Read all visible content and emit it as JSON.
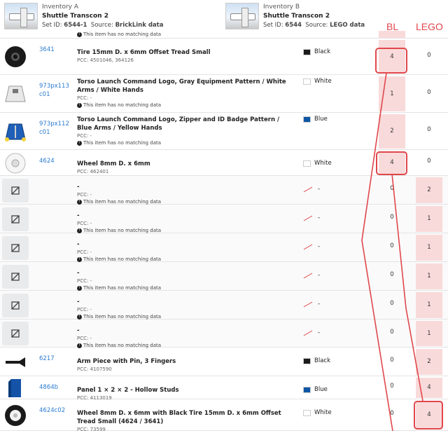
{
  "inventory_a": {
    "label": "Inventory A",
    "name": "Shuttle Transcon 2",
    "set_id_label": "Set ID:",
    "set_id": "6544-1",
    "source_label": "Source:",
    "source": "BrickLink data"
  },
  "inventory_b": {
    "label": "Inventory B",
    "name": "Shuttle Transcon 2",
    "set_id_label": "Set ID:",
    "set_id": "6544",
    "source_label": "Source:",
    "source": "LEGO data"
  },
  "columns": {
    "bl": "BL",
    "lego": "LEGO"
  },
  "top_partial_note": "This item has no matching data",
  "rows": [
    {
      "id": "3641",
      "name": "Tire 15mm D. x 6mm Offset Tread Small",
      "pcc": "PCC: 4501046, 364126",
      "nomatch": "",
      "color": "Black",
      "swatch": "#1b1b1b",
      "bl": "4",
      "lego": "0",
      "thumb": "tire"
    },
    {
      "id": "973px113c01",
      "name": "Torso Launch Command Logo, Gray Equipment Pattern / White Arms / White Hands",
      "pcc": "PCC: -",
      "nomatch": "This item has no matching data",
      "color": "White",
      "swatch": "#ffffff",
      "bl": "1",
      "lego": "0",
      "thumb": "torso-white"
    },
    {
      "id": "973px112c01",
      "name": "Torso Launch Command Logo, Zipper and ID Badge Pattern / Blue Arms / Yellow Hands",
      "pcc": "PCC: -",
      "nomatch": "This item has no matching data",
      "color": "Blue",
      "swatch": "#0d56a6",
      "bl": "2",
      "lego": "0",
      "thumb": "torso-blue"
    },
    {
      "id": "4624",
      "name": "Wheel 8mm D. x 6mm",
      "pcc": "PCC: 462401",
      "nomatch": "",
      "color": "White",
      "swatch": "#ffffff",
      "bl": "4",
      "lego": "0",
      "thumb": "wheel"
    },
    {
      "id": "",
      "name": "-",
      "pcc": "PCC: -",
      "nomatch": "This item has no matching data",
      "color": "-",
      "swatch": "none",
      "bl": "0",
      "lego": "2",
      "thumb": "ph"
    },
    {
      "id": "",
      "name": "-",
      "pcc": "PCC: -",
      "nomatch": "This item has no matching data",
      "color": "-",
      "swatch": "none",
      "bl": "0",
      "lego": "1",
      "thumb": "ph"
    },
    {
      "id": "",
      "name": "-",
      "pcc": "PCC: -",
      "nomatch": "This item has no matching data",
      "color": "-",
      "swatch": "none",
      "bl": "0",
      "lego": "1",
      "thumb": "ph"
    },
    {
      "id": "",
      "name": "-",
      "pcc": "PCC: -",
      "nomatch": "This item has no matching data",
      "color": "-",
      "swatch": "none",
      "bl": "0",
      "lego": "1",
      "thumb": "ph"
    },
    {
      "id": "",
      "name": "-",
      "pcc": "PCC: -",
      "nomatch": "This item has no matching data",
      "color": "-",
      "swatch": "none",
      "bl": "0",
      "lego": "1",
      "thumb": "ph"
    },
    {
      "id": "",
      "name": "-",
      "pcc": "PCC: -",
      "nomatch": "This item has no matching data",
      "color": "-",
      "swatch": "none",
      "bl": "0",
      "lego": "1",
      "thumb": "ph"
    },
    {
      "id": "6217",
      "name": "Arm Piece with Pin, 3 Fingers",
      "pcc": "PCC: 4107590",
      "nomatch": "",
      "color": "Black",
      "swatch": "#1b1b1b",
      "bl": "0",
      "lego": "2",
      "thumb": "arm"
    },
    {
      "id": "4864b",
      "name": "Panel 1 × 2 × 2 - Hollow Studs",
      "pcc": "PCC: 4113019",
      "nomatch": "",
      "color": "Blue",
      "swatch": "#0d56a6",
      "bl": "0",
      "lego": "4",
      "thumb": "panel"
    },
    {
      "id": "4624c02",
      "name": "Wheel 8mm D. x 6mm with Black Tire 15mm D. x 6mm Offset Tread Small (4624 / 3641)",
      "pcc": "PCC: 73599",
      "nomatch": "",
      "color": "White",
      "swatch": "#ffffff",
      "bl": "0",
      "lego": "4",
      "thumb": "wheel-tire"
    }
  ]
}
